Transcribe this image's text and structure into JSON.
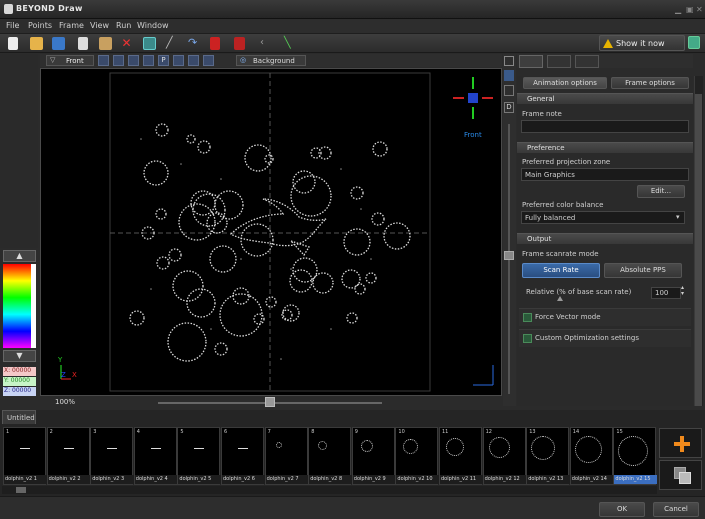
{
  "app": {
    "title": "BEYOND Draw"
  },
  "menu": [
    "File",
    "Points",
    "Frame",
    "View",
    "Run",
    "Window"
  ],
  "toolbar": {
    "show_it_now": "Show it now"
  },
  "viewbar": {
    "view_name": "Front",
    "background_label": "Background",
    "view_labels": [
      "F",
      "P"
    ]
  },
  "viewport": {
    "zoom": "100%",
    "gizmo_label": "Front",
    "axis_y": "Y",
    "axis_z": "Z",
    "axis_x": "X"
  },
  "coords": {
    "x": "X: 00000",
    "y": "Y: 00000",
    "z": "Z: 00000"
  },
  "panel": {
    "tabs": [
      "Animation options",
      "Frame options"
    ],
    "general": "General",
    "frame_note_label": "Frame note",
    "frame_note_value": "",
    "preference": "Preference",
    "projection_zone_label": "Preferred projection zone",
    "projection_zone_value": "Main Graphics",
    "edit_button": "Edit...",
    "color_balance_label": "Preferred color balance",
    "color_balance_value": "Fully balanced",
    "output": "Output",
    "scanrate_mode_label": "Frame scanrate mode",
    "scan_rate_button": "Scan Rate",
    "absolute_pps_button": "Absolute PPS",
    "relative_label": "Relative (% of base scan rate)",
    "relative_value": "100",
    "force_vector_label": "Force Vector mode",
    "custom_opt_label": "Custom Optimization settings"
  },
  "timeline": {
    "tab": "Untitled",
    "frames": [
      {
        "num": "1",
        "label": "dolphin_v2 1"
      },
      {
        "num": "2",
        "label": "dolphin_v2 2"
      },
      {
        "num": "3",
        "label": "dolphin_v2 3"
      },
      {
        "num": "4",
        "label": "dolphin_v2 4"
      },
      {
        "num": "5",
        "label": "dolphin_v2 5"
      },
      {
        "num": "6",
        "label": "dolphin_v2 6"
      },
      {
        "num": "7",
        "label": "dolphin_v2 7"
      },
      {
        "num": "8",
        "label": "dolphin_v2 8"
      },
      {
        "num": "9",
        "label": "dolphin_v2 9"
      },
      {
        "num": "10",
        "label": "dolphin_v2 10"
      },
      {
        "num": "11",
        "label": "dolphin_v2 11"
      },
      {
        "num": "12",
        "label": "dolphin_v2 12"
      },
      {
        "num": "13",
        "label": "dolphin_v2 13"
      },
      {
        "num": "14",
        "label": "dolphin_v2 14"
      },
      {
        "num": "15",
        "label": "dolphin_v2 15"
      }
    ],
    "selected_frame": "15"
  },
  "footer": {
    "ok": "OK",
    "cancel": "Cancel"
  },
  "colors": {
    "accent": "#3b6ec0",
    "warning": "#e8b400",
    "add_plus": "#f08a1c"
  }
}
